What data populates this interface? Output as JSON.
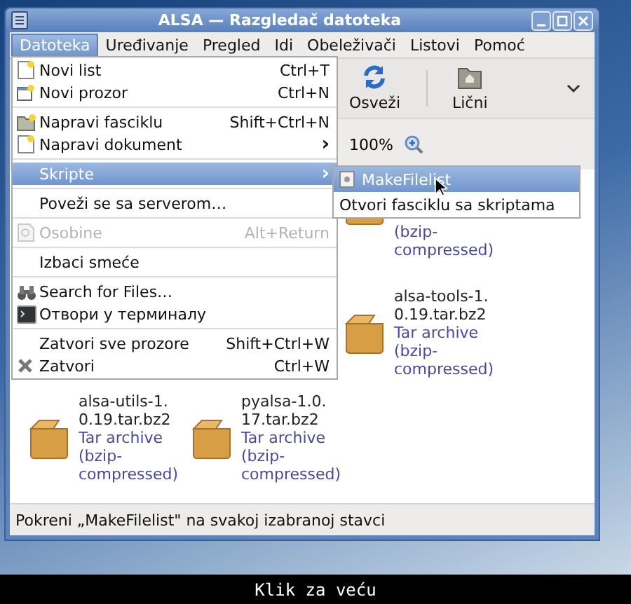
{
  "window": {
    "title": "ALSA — Razgledač datoteka"
  },
  "menubar": [
    {
      "label": "Datoteka",
      "selected": true
    },
    {
      "label": "Uređivanje",
      "selected": false
    },
    {
      "label": "Pregled",
      "selected": false
    },
    {
      "label": "Idi",
      "selected": false
    },
    {
      "label": "Obeleživači",
      "selected": false
    },
    {
      "label": "Listovi",
      "selected": false
    },
    {
      "label": "Pomoć",
      "selected": false
    }
  ],
  "toolbar": [
    {
      "label": "Osveži"
    },
    {
      "label": "Lični"
    }
  ],
  "zoom": {
    "value": "100%"
  },
  "files": [
    {
      "type": [
        "(bzip-",
        "compressed)"
      ]
    },
    {
      "name": [
        "alsa-tools-1.",
        "0.19.tar.bz2"
      ],
      "type": [
        "Tar archive",
        "(bzip-",
        "compressed)"
      ]
    },
    {
      "name": [
        "alsa-utils-1.",
        "0.19.tar.bz2"
      ],
      "type": [
        "Tar archive",
        "(bzip-",
        "compressed)"
      ]
    },
    {
      "name": [
        "pyalsa-1.0.",
        "17.tar.bz2"
      ],
      "type": [
        "Tar archive",
        "(bzip-",
        "compressed)"
      ]
    }
  ],
  "file_menu": [
    {
      "kind": "item",
      "label": "Novi list",
      "shortcut": "Ctrl+T",
      "selected": false,
      "disabled": false
    },
    {
      "kind": "item",
      "label": "Novi prozor",
      "shortcut": "Ctrl+N",
      "selected": false,
      "disabled": false
    },
    {
      "kind": "separator"
    },
    {
      "kind": "item",
      "label": "Napravi fasciklu",
      "shortcut": "Shift+Ctrl+N",
      "selected": false,
      "disabled": false
    },
    {
      "kind": "submenu",
      "label": "Napravi dokument",
      "arrow": "›",
      "selected": false,
      "disabled": false
    },
    {
      "kind": "separator"
    },
    {
      "kind": "submenu",
      "label": "Skripte",
      "arrow": "›",
      "selected": true,
      "disabled": false
    },
    {
      "kind": "separator"
    },
    {
      "kind": "item",
      "label": "Poveži se sa serverom…",
      "selected": false,
      "disabled": false
    },
    {
      "kind": "separator"
    },
    {
      "kind": "item",
      "label": "Osobine",
      "shortcut": "Alt+Return",
      "selected": false,
      "disabled": true
    },
    {
      "kind": "separator"
    },
    {
      "kind": "item",
      "label": "Izbaci smeće",
      "selected": false,
      "disabled": false
    },
    {
      "kind": "separator"
    },
    {
      "kind": "item",
      "label": "Search for Files…",
      "selected": false,
      "disabled": false
    },
    {
      "kind": "item",
      "label": "Отвори у терминалу",
      "selected": false,
      "disabled": false
    },
    {
      "kind": "separator"
    },
    {
      "kind": "item",
      "label": "Zatvori sve prozore",
      "shortcut": "Shift+Ctrl+W",
      "selected": false,
      "disabled": false
    },
    {
      "kind": "item",
      "label": "Zatvori",
      "shortcut": "Ctrl+W",
      "selected": false,
      "disabled": false
    }
  ],
  "scripts_menu": [
    {
      "label": "MakeFilelist",
      "selected": true
    },
    {
      "label": "Otvori fasciklu sa skriptama",
      "selected": false
    }
  ],
  "status_bar": "Pokreni „MakeFilelist\" na svakoj izabranoj stavci",
  "caption": "Klik za veću"
}
